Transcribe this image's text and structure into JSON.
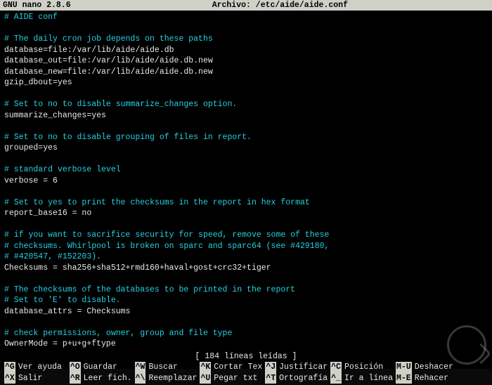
{
  "titlebar": {
    "app": "GNU nano 2.8.6",
    "file_label": "Archivo: /etc/aide/aide.conf"
  },
  "lines": [
    {
      "c": "cyan",
      "t": "# AIDE conf"
    },
    {
      "c": "white",
      "t": ""
    },
    {
      "c": "cyan",
      "t": "# The daily cron job depends on these paths"
    },
    {
      "c": "white",
      "t": "database=file:/var/lib/aide/aide.db"
    },
    {
      "c": "white",
      "t": "database_out=file:/var/lib/aide/aide.db.new"
    },
    {
      "c": "white",
      "t": "database_new=file:/var/lib/aide/aide.db.new"
    },
    {
      "c": "white",
      "t": "gzip_dbout=yes"
    },
    {
      "c": "white",
      "t": ""
    },
    {
      "c": "cyan",
      "t": "# Set to no to disable summarize_changes option."
    },
    {
      "c": "white",
      "t": "summarize_changes=yes"
    },
    {
      "c": "white",
      "t": ""
    },
    {
      "c": "cyan",
      "t": "# Set to no to disable grouping of files in report."
    },
    {
      "c": "white",
      "t": "grouped=yes"
    },
    {
      "c": "white",
      "t": ""
    },
    {
      "c": "cyan",
      "t": "# standard verbose level"
    },
    {
      "c": "white",
      "t": "verbose = 6"
    },
    {
      "c": "white",
      "t": ""
    },
    {
      "c": "cyan",
      "t": "# Set to yes to print the checksums in the report in hex format"
    },
    {
      "c": "white",
      "t": "report_base16 = no"
    },
    {
      "c": "white",
      "t": ""
    },
    {
      "c": "cyan",
      "t": "# if you want to sacrifice security for speed, remove some of these"
    },
    {
      "c": "cyan",
      "t": "# checksums. Whirlpool is broken on sparc and sparc64 (see #429180,"
    },
    {
      "c": "cyan",
      "t": "# #420547, #152203)."
    },
    {
      "c": "white",
      "t": "Checksums = sha256+sha512+rmd160+haval+gost+crc32+tiger"
    },
    {
      "c": "white",
      "t": ""
    },
    {
      "c": "cyan",
      "t": "# The checksums of the databases to be printed in the report"
    },
    {
      "c": "cyan",
      "t": "# Set to 'E' to disable."
    },
    {
      "c": "white",
      "t": "database_attrs = Checksums"
    },
    {
      "c": "white",
      "t": ""
    },
    {
      "c": "cyan",
      "t": "# check permissions, owner, group and file type"
    },
    {
      "c": "white",
      "t": "OwnerMode = p+u+g+ftype"
    }
  ],
  "status": "[ 184 líneas leídas ]",
  "shortcuts": {
    "row1": [
      {
        "k": "^G",
        "l": "Ver ayuda "
      },
      {
        "k": "^O",
        "l": "Guardar   "
      },
      {
        "k": "^W",
        "l": "Buscar    "
      },
      {
        "k": "^K",
        "l": "Cortar Tex"
      },
      {
        "k": "^J",
        "l": "Justificar"
      },
      {
        "k": "^C",
        "l": "Posición  "
      },
      {
        "k": "M-U",
        "l": "Deshacer"
      }
    ],
    "row2": [
      {
        "k": "^X",
        "l": "Salir     "
      },
      {
        "k": "^R",
        "l": "Leer fich."
      },
      {
        "k": "^\\",
        "l": "Reemplazar"
      },
      {
        "k": "^U",
        "l": "Pegar txt "
      },
      {
        "k": "^T",
        "l": "Ortografía"
      },
      {
        "k": "^_",
        "l": "Ir a línea"
      },
      {
        "k": "M-E",
        "l": "Rehacer "
      }
    ]
  }
}
